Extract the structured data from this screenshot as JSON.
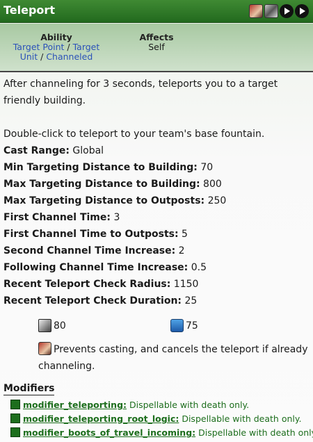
{
  "header": {
    "title": "Teleport",
    "icons": [
      "hero-portrait-icon",
      "boots-icon",
      "play-icon",
      "play-next-icon"
    ]
  },
  "info": {
    "ability_head": "Ability",
    "ability_parts": {
      "target_point": "Target Point",
      "sep1": " / ",
      "target_unit": "Target Unit",
      "sep2": " / ",
      "channeled": "Channeled"
    },
    "affects_head": "Affects",
    "affects_value": "Self"
  },
  "description": {
    "main": "After channeling for 3 seconds, teleports you to a target friendly building.",
    "extra": "Double-click to teleport to your team's base fountain."
  },
  "properties": [
    {
      "key": "Cast Range:",
      "value": " Global"
    },
    {
      "key": "Min Targeting Distance to Building:",
      "value": " 70"
    },
    {
      "key": "Max Targeting Distance to Building:",
      "value": " 800"
    },
    {
      "key": "Max Targeting Distance to Outposts:",
      "value": " 250"
    },
    {
      "key": "First Channel Time:",
      "value": " 3"
    },
    {
      "key": "First Channel Time to Outposts:",
      "value": " 5"
    },
    {
      "key": "Second Channel Time Increase:",
      "value": " 2"
    },
    {
      "key": "Following Channel Time Increase:",
      "value": " 0.5"
    },
    {
      "key": "Recent Teleport Check Radius:",
      "value": " 1150"
    },
    {
      "key": "Recent Teleport Check Duration:",
      "value": " 25"
    }
  ],
  "costs": {
    "cooldown": "80",
    "mana": "75"
  },
  "note": "Prevents casting, and cancels the teleport if already channeling.",
  "modifiers": {
    "title": "Modifiers",
    "items": [
      {
        "name": "modifier_teleporting:",
        "desc": " Dispellable with death only."
      },
      {
        "name": "modifier_teleporting_root_logic:",
        "desc": " Dispellable with death only."
      },
      {
        "name": "modifier_boots_of_travel_incoming:",
        "desc": " Dispellable with death only."
      }
    ]
  },
  "colors": {
    "header_green": "#2f7a28",
    "link_blue": "#2b52b8",
    "modifier_green": "#1d6e1d",
    "mana_blue": "#2e7fd0"
  }
}
